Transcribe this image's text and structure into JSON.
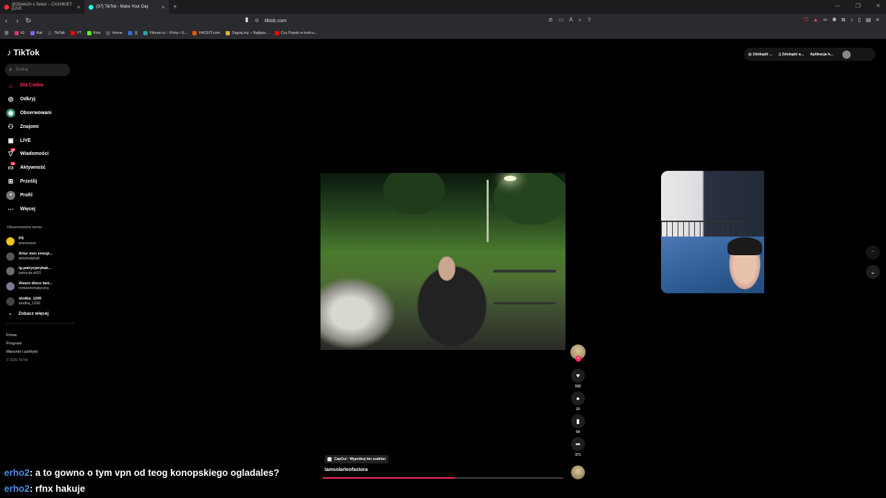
{
  "browser": {
    "tabs": [
      {
        "title": "@Ziolek2h x Sebol – CASHKIET [LIVE",
        "favicon_color": "#ff2d2d",
        "active": false
      },
      {
        "title": "(37) TikTok - Make Your Day",
        "favicon_color": "#25f4ee",
        "active": true
      }
    ],
    "new_tab": "+",
    "url": "tiktok.com",
    "bookmarks": [
      {
        "label": "IG",
        "color": "#e1306c"
      },
      {
        "label": "Rat",
        "color": "#8a5cf6"
      },
      {
        "label": "TikTok",
        "color": "#111111"
      },
      {
        "label": "YT",
        "color": "#ff0000"
      },
      {
        "label": "Kick",
        "color": "#53fc18"
      },
      {
        "label": "Home",
        "color": "#111111"
      },
      {
        "label": "天",
        "color": "#3b6bd6"
      },
      {
        "label": "Filman.cc - Filmy i S...",
        "color": "#2aa6a6"
      },
      {
        "label": "FACEIT.com",
        "color": "#ff5500"
      },
      {
        "label": "Zagraj.my – Najleps...",
        "color": "#e0b040"
      },
      {
        "label": "Czy Popek w końcu...",
        "color": "#ff0000"
      }
    ]
  },
  "sidebar": {
    "logo": "TikTok",
    "search_placeholder": "Szukaj",
    "items": [
      {
        "label": "Dla Ciebie",
        "icon": "home-icon",
        "glyph": "⌂",
        "active": true
      },
      {
        "label": "Odkryj",
        "icon": "compass-icon",
        "glyph": "◎"
      },
      {
        "label": "Obserwowani",
        "icon": "following-icon",
        "glyph": "◉"
      },
      {
        "label": "Znajomi",
        "icon": "friends-icon",
        "glyph": "⚇"
      },
      {
        "label": "LIVE",
        "icon": "live-icon",
        "glyph": "▣"
      },
      {
        "label": "Wiadomości",
        "icon": "messages-icon",
        "glyph": "▽",
        "badge": "23"
      },
      {
        "label": "Aktywność",
        "icon": "activity-icon",
        "glyph": "▭",
        "badge": "16"
      },
      {
        "label": "Prześlij",
        "icon": "upload-icon",
        "glyph": "⊞"
      },
      {
        "label": "Profil",
        "icon": "profile-icon",
        "glyph": "●"
      },
      {
        "label": "Więcej",
        "icon": "more-icon",
        "glyph": "⋯"
      }
    ],
    "following_title": "Obserwowane konta",
    "following": [
      {
        "name": "PS",
        "user": "pszszszsz",
        "color": "#f5c518"
      },
      {
        "name": "Artur moc energi...",
        "user": "arturindyka6",
        "color": "#555555"
      },
      {
        "name": "ig:patrycjarybak...",
        "user": "patrycja.wl10",
        "color": "#6b6b6b"
      },
      {
        "name": "Alvaro disco tani...",
        "user": "romeoromatyczny",
        "color": "#7a7a9a"
      },
      {
        "name": "slodka_1200",
        "user": "slodka_1200",
        "color": "#444444"
      }
    ],
    "see_more": "Zobacz więcej",
    "footer_links": [
      "Firma",
      "Program",
      "Warunki i polityki"
    ],
    "copyright": "© 2025 TikTok"
  },
  "header": {
    "buttons": [
      "Zdobądź ...",
      "Zdobądź a...",
      "Aplikacja k..."
    ]
  },
  "video": {
    "capcut_label": "CapCut · Wypróbuj ten szablon",
    "author": "Iamsolarleofastora",
    "progress": 0.55
  },
  "actions": {
    "likes": "592",
    "comments": "10",
    "saves": "64",
    "shares": "371"
  },
  "chat": [
    {
      "nick": "erho2",
      "text": ": a to gowno o tym vpn od teog konopskiego ogladales?"
    },
    {
      "nick": "erho2",
      "text": ": rfnx hakuje"
    }
  ]
}
